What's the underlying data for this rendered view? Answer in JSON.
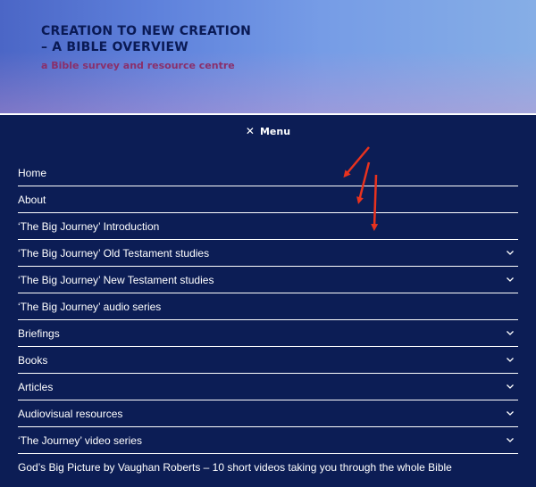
{
  "site": {
    "title_line1": "CREATION TO NEW CREATION",
    "title_line2": "– A BIBLE OVERVIEW",
    "tagline": "a Bible survey and resource centre"
  },
  "nav": {
    "toggle_icon": "✕",
    "toggle_label": "Menu",
    "items": [
      {
        "label": "Home",
        "has_submenu": false
      },
      {
        "label": "About",
        "has_submenu": false
      },
      {
        "label": "‘The Big Journey’ Introduction",
        "has_submenu": false
      },
      {
        "label": "‘The Big Journey’ Old Testament studies",
        "has_submenu": true
      },
      {
        "label": "‘The Big Journey’ New Testament studies",
        "has_submenu": true
      },
      {
        "label": "‘The Big Journey’ audio series",
        "has_submenu": false
      },
      {
        "label": "Briefings",
        "has_submenu": true
      },
      {
        "label": "Books",
        "has_submenu": true
      },
      {
        "label": "Articles",
        "has_submenu": true
      },
      {
        "label": "Audiovisual resources",
        "has_submenu": true
      },
      {
        "label": "‘The Journey’ video series",
        "has_submenu": true
      },
      {
        "label": "God’s Big Picture by Vaughan Roberts – 10 short videos taking you through the whole Bible",
        "has_submenu": false
      }
    ]
  },
  "colors": {
    "nav_background": "#0c1d55",
    "title_color": "#0a1a55",
    "tagline_color": "#8a2f6a",
    "annotation_arrow": "#e8321e"
  }
}
